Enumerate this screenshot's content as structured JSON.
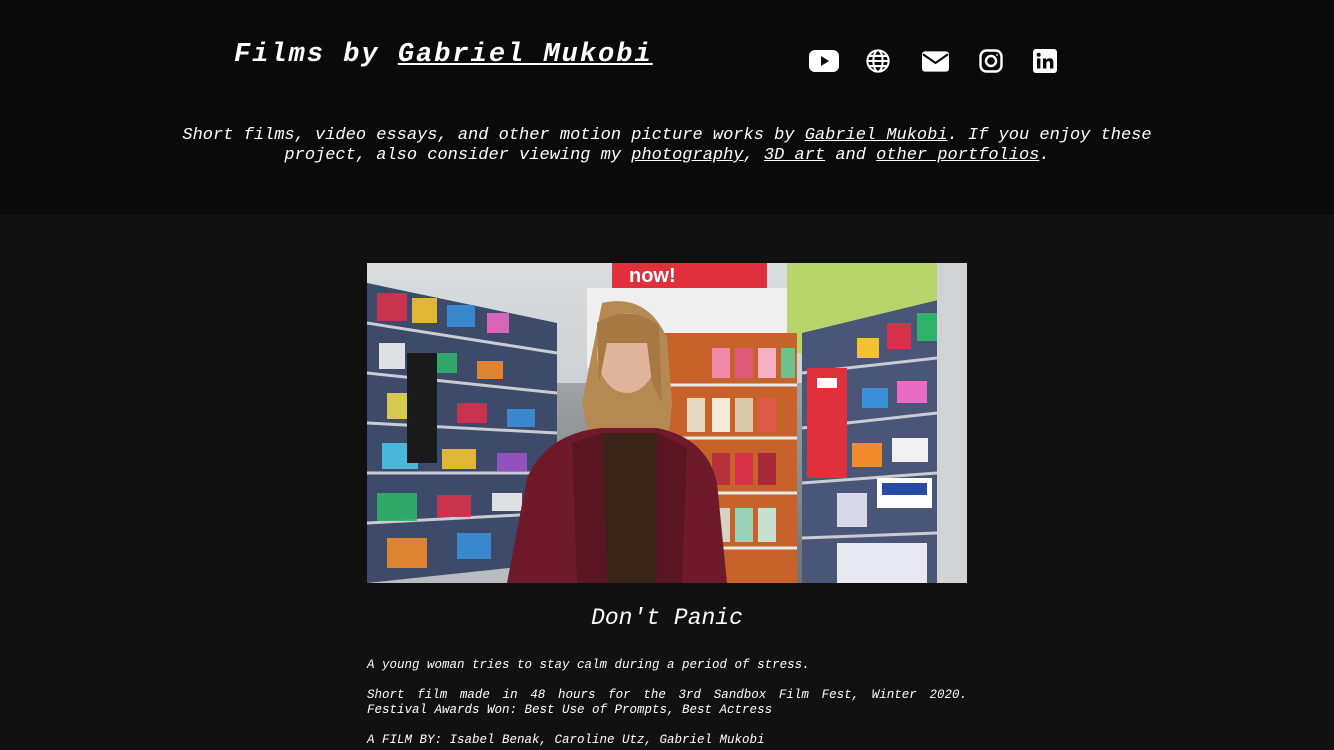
{
  "header": {
    "title_prefix": "Films by ",
    "title_name": "Gabriel Mukobi",
    "social_icons": [
      "youtube-icon",
      "globe-icon",
      "envelope-icon",
      "instagram-icon",
      "linkedin-icon"
    ]
  },
  "intro": {
    "part1": "Short films, video essays, and other motion picture works by ",
    "name_link": "Gabriel Mukobi",
    "part2": ". If you enjoy these project, also consider viewing my ",
    "photography_link": "photography",
    "comma": ", ",
    "art_link": "3D art",
    "and": " and ",
    "portfolios_link": "other portfolios",
    "period": "."
  },
  "film": {
    "title": "Don't Panic",
    "logline": "A young woman tries to stay calm during a period of stress.",
    "made_line": "Short film made in 48 hours for the 3rd Sandbox Film Fest, Winter 2020.",
    "awards_line": "Festival Awards Won: Best Use of Prompts, Best Actress",
    "credits_line": "A FILM BY: Isabel Benak, Caroline Utz, Gabriel Mukobi",
    "store_sign": "now!"
  },
  "colors": {
    "page_bg": "#111111",
    "header_bg": "#0a0a0a",
    "text": "#ffffff",
    "jacket": "#6e1a2a",
    "sign_red": "#e0303c"
  }
}
